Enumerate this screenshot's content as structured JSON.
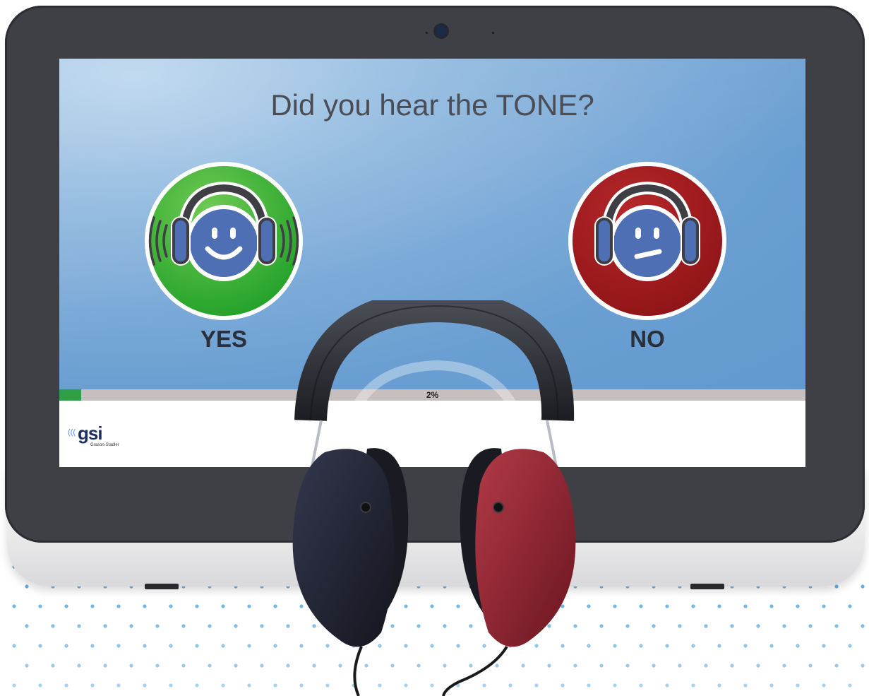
{
  "screen": {
    "question": "Did you hear the TONE?",
    "yes": {
      "label": "YES",
      "color": "#2fae38",
      "icon": "happy-face-headphones-icon"
    },
    "no": {
      "label": "NO",
      "color": "#a0181b",
      "icon": "neutral-face-headphones-icon"
    },
    "progress": {
      "text": "2%",
      "value": 0.02,
      "color": "#2ea043"
    },
    "logo": {
      "name": "gsi",
      "subtitle": "Grason-Stadler"
    }
  },
  "device": {
    "camera": "webcam-icon"
  },
  "accessory": {
    "headphones": "audiometric-headphones",
    "left_color": "#1f2235",
    "right_color": "#8a1d2a"
  }
}
